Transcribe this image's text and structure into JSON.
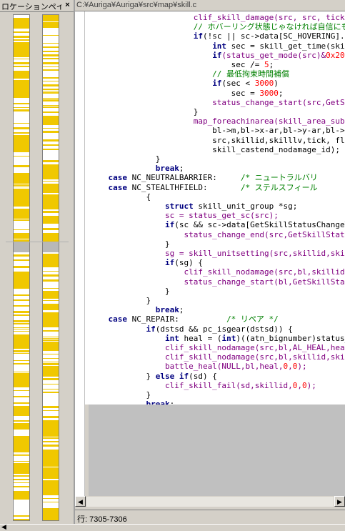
{
  "location_pane": {
    "title": "ロケーションペイン",
    "close_label": "×"
  },
  "editor": {
    "path": "C:¥Auriga¥Auriga¥src¥map¥skill.c",
    "code_lines": [
      [
        {
          "t": "        clif_skill_damage(src, src, tick, 0, 0,",
          "c": "fn"
        }
      ],
      [
        {
          "t": "        // ホバーリング状態じゃなければ自信にも付",
          "c": "cm"
        }
      ],
      [
        {
          "t": "        ",
          "c": "tx"
        },
        {
          "t": "if",
          "c": "kw"
        },
        {
          "t": "(!sc || sc->data[SC_HOVERING].timer ==",
          "c": "tx"
        }
      ],
      [
        {
          "t": "            ",
          "c": "tx"
        },
        {
          "t": "int",
          "c": "kw"
        },
        {
          "t": " sec = skill_get_time(skillid,sk",
          "c": "tx"
        }
      ],
      [
        {
          "t": "            ",
          "c": "tx"
        },
        {
          "t": "if",
          "c": "kw"
        },
        {
          "t": "(status_get_mode(src)&",
          "c": "fn"
        },
        {
          "t": "0x20",
          "c": "nm"
        },
        {
          "t": ")",
          "c": "fn"
        }
      ],
      [
        {
          "t": "                sec /= ",
          "c": "tx"
        },
        {
          "t": "5",
          "c": "nm"
        },
        {
          "t": ";",
          "c": "tx"
        }
      ],
      [
        {
          "t": "            // 最低拘束時間補償",
          "c": "cm"
        }
      ],
      [
        {
          "t": "            ",
          "c": "tx"
        },
        {
          "t": "if",
          "c": "kw"
        },
        {
          "t": "(sec < ",
          "c": "tx"
        },
        {
          "t": "3000",
          "c": "nm"
        },
        {
          "t": ")",
          "c": "tx"
        }
      ],
      [
        {
          "t": "                sec = ",
          "c": "tx"
        },
        {
          "t": "3000",
          "c": "nm"
        },
        {
          "t": ";",
          "c": "tx"
        }
      ],
      [
        {
          "t": "            status_change_start(src,GetSkillSta",
          "c": "fn"
        }
      ],
      [
        {
          "t": "        }",
          "c": "tx"
        }
      ],
      [
        {
          "t": "        map_foreachinarea(skill_area_sub,",
          "c": "fn"
        }
      ],
      [
        {
          "t": "            bl->m,bl->x-ar,bl->y-ar,bl->x+ar,bl-",
          "c": "tx"
        }
      ],
      [
        {
          "t": "            src,skillid,skilllv,tick, flag|BCT_",
          "c": "tx"
        }
      ],
      [
        {
          "t": "            skill_castend_nodamage_id);",
          "c": "tx"
        }
      ],
      [
        {
          "t": "    }",
          "c": "tx"
        }
      ],
      [
        {
          "t": "    ",
          "c": "tx"
        },
        {
          "t": "break",
          "c": "kw"
        },
        {
          "t": ";",
          "c": "tx"
        }
      ],
      [
        {
          "t": "case",
          "c": "kw"
        },
        {
          "t": " NC_NEUTRALBARRIER:     ",
          "c": "tx"
        },
        {
          "t": "/* ニュートラルバリ",
          "c": "cm"
        }
      ],
      [
        {
          "t": "case",
          "c": "kw"
        },
        {
          "t": " NC_STEALTHFIELD:       ",
          "c": "tx"
        },
        {
          "t": "/* ステルスフィール",
          "c": "cm"
        }
      ],
      [
        {
          "t": "    {",
          "c": "tx"
        }
      ],
      [
        {
          "t": "        ",
          "c": "tx"
        },
        {
          "t": "struct",
          "c": "kw"
        },
        {
          "t": " skill_unit_group *sg;",
          "c": "tx"
        }
      ],
      [
        {
          "t": "        sc = status_get_sc(src);",
          "c": "fn"
        }
      ],
      [
        {
          "t": "        ",
          "c": "tx"
        },
        {
          "t": "if",
          "c": "kw"
        },
        {
          "t": "(sc && sc->data[GetSkillStatusChangeTa",
          "c": "tx"
        }
      ],
      [
        {
          "t": "            status_change_end(src,GetSkillStatus",
          "c": "fn"
        }
      ],
      [
        {
          "t": "        }",
          "c": "tx"
        }
      ],
      [
        {
          "t": "        sg = skill_unitsetting(src,skillid,skil",
          "c": "fn"
        }
      ],
      [
        {
          "t": "        ",
          "c": "tx"
        },
        {
          "t": "if",
          "c": "kw"
        },
        {
          "t": "(sg) {",
          "c": "tx"
        }
      ],
      [
        {
          "t": "            clif_skill_nodamage(src,bl,skillid,s",
          "c": "fn"
        }
      ],
      [
        {
          "t": "            status_change_start(bl,GetSkillStat",
          "c": "fn"
        }
      ],
      [
        {
          "t": "        }",
          "c": "tx"
        }
      ],
      [
        {
          "t": "    }",
          "c": "tx"
        }
      ],
      [
        {
          "t": "    ",
          "c": "tx"
        },
        {
          "t": "break",
          "c": "kw"
        },
        {
          "t": ";",
          "c": "tx"
        }
      ],
      [
        {
          "t": "case",
          "c": "kw"
        },
        {
          "t": " NC_REPAIR:          ",
          "c": "tx"
        },
        {
          "t": "/* リペア */",
          "c": "cm"
        }
      ],
      [
        {
          "t": "    ",
          "c": "tx"
        },
        {
          "t": "if",
          "c": "kw"
        },
        {
          "t": "(dstsd && pc_isgear(dstsd)) {",
          "c": "tx"
        }
      ],
      [
        {
          "t": "        ",
          "c": "tx"
        },
        {
          "t": "int",
          "c": "kw"
        },
        {
          "t": " heal = (",
          "c": "tx"
        },
        {
          "t": "int",
          "c": "kw"
        },
        {
          "t": ")((atn_bignumber)status_g",
          "c": "tx"
        }
      ],
      [
        {
          "t": "        clif_skill_nodamage(src,bl,AL_HEAL,heal",
          "c": "fn"
        }
      ],
      [
        {
          "t": "        clif_skill_nodamage(src,bl,skillid,skil",
          "c": "fn"
        }
      ],
      [
        {
          "t": "        battle_heal(NULL,bl,heal,",
          "c": "fn"
        },
        {
          "t": "0",
          "c": "nm"
        },
        {
          "t": ",",
          "c": "fn"
        },
        {
          "t": "0",
          "c": "nm"
        },
        {
          "t": ");",
          "c": "fn"
        }
      ],
      [
        {
          "t": "    } ",
          "c": "tx"
        },
        {
          "t": "else if",
          "c": "kw"
        },
        {
          "t": "(sd) {",
          "c": "tx"
        }
      ],
      [
        {
          "t": "        clif_skill_fail(sd,skillid,",
          "c": "fn"
        },
        {
          "t": "0",
          "c": "nm"
        },
        {
          "t": ",",
          "c": "fn"
        },
        {
          "t": "0",
          "c": "nm"
        },
        {
          "t": ");",
          "c": "fn"
        }
      ],
      [
        {
          "t": "    }",
          "c": "tx"
        }
      ],
      [
        {
          "t": "    ",
          "c": "tx"
        },
        {
          "t": "break",
          "c": "kw"
        },
        {
          "t": ";",
          "c": "tx"
        }
      ]
    ],
    "line_indent_spaces": [
      14,
      14,
      14,
      14,
      14,
      14,
      14,
      14,
      14,
      14,
      14,
      14,
      14,
      14,
      14,
      10,
      10,
      4,
      4,
      8,
      8,
      8,
      8,
      8,
      8,
      8,
      8,
      8,
      8,
      8,
      8,
      10,
      4,
      8,
      8,
      8,
      8,
      8,
      8,
      8,
      8,
      8
    ]
  },
  "status_bar": {
    "text": "行: 7305-7306"
  },
  "colors": {
    "keyword": "#000080",
    "function": "#800080",
    "comment": "#008000",
    "number": "#ff0000",
    "marker": "#f0c800"
  },
  "icons": {
    "scroll_left": "arrow-left-icon",
    "scroll_right": "arrow-right-icon",
    "close": "close-icon"
  }
}
